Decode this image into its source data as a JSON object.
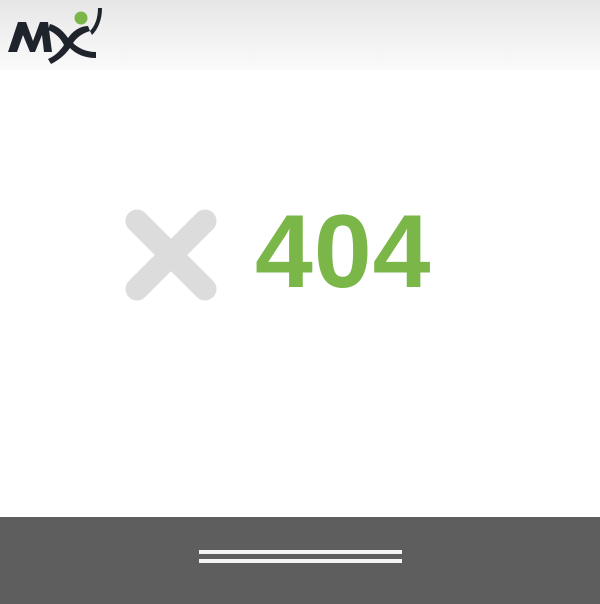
{
  "header": {
    "logo_text": "MX",
    "logo_icon": "mx-logo-icon",
    "colors": {
      "logo_dark": "#1f232c",
      "logo_accent": "#7ab648",
      "background": "#f0f0f0"
    }
  },
  "main": {
    "error_icon": "x-icon",
    "error_code": "404",
    "colors": {
      "code": "#7ab648",
      "icon": "#dcdcdc"
    }
  },
  "footer": {
    "menu_icon": "menu-lines-icon",
    "colors": {
      "background": "#5e5e5e",
      "lines": "#f4f4f4"
    }
  }
}
